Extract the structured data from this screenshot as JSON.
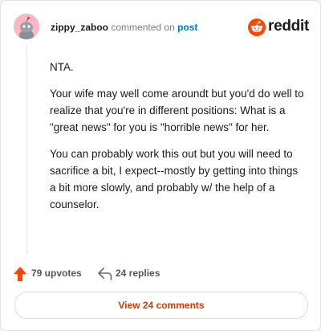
{
  "comment": {
    "username": "zippy_zaboo",
    "action_text": "commented on",
    "target_link": "post",
    "body": [
      "NTA.",
      "Your wife may well come aroundt but you'd do well to realize that you're in different positions: What is a \"great news\" for you is \"horrible news\" for her.",
      "You can probably work this out but you will need to sacrifice a bit, I expect--mostly by getting into things a bit more slowly, and probably w/ the help of a counselor."
    ]
  },
  "brand": {
    "name": "reddit",
    "logo_icon": "reddit-snoo-icon",
    "accent": "#ff4500"
  },
  "actions": {
    "upvotes_label": "79 upvotes",
    "replies_label": "24 replies",
    "upvote_icon": "upvote-arrow-icon",
    "reply_icon": "reply-arrow-icon",
    "upvote_color": "#ff4500"
  },
  "footer": {
    "view_comments_label": "View 24 comments",
    "link_color": "#d93a00"
  }
}
